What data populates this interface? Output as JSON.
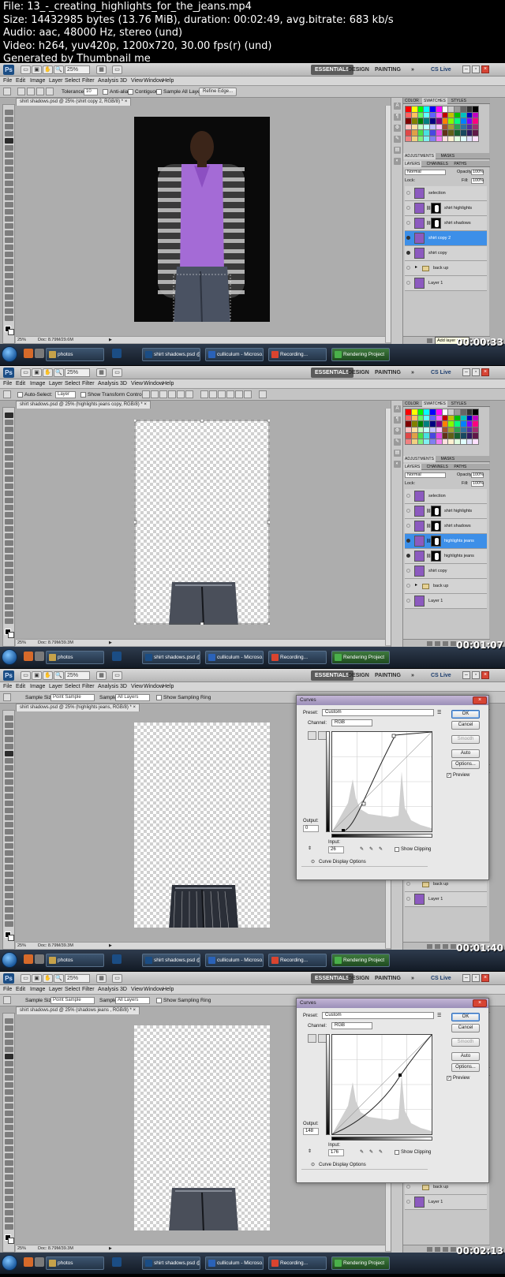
{
  "header": {
    "file": "File: 13_-_creating_highlights_for_the_jeans.mp4",
    "size": "Size: 14432985 bytes (13.76 MiB), duration: 00:02:49, avg.bitrate: 683 kb/s",
    "audio": "Audio: aac, 48000 Hz, stereo (und)",
    "video": "Video: h264, yuv420p, 1200x720, 30.00 fps(r) (und)",
    "generated": "Generated by Thumbnail me"
  },
  "app": {
    "logo": "Ps",
    "zoom": "25%",
    "workspaces": [
      "ESSENTIALS",
      "DESIGN",
      "PAINTING"
    ],
    "more": "»",
    "cs_live": "CS Live",
    "menu": [
      "File",
      "Edit",
      "Image",
      "Layer",
      "Select",
      "Filter",
      "Analysis",
      "3D",
      "View",
      "Window",
      "Help"
    ],
    "panel_tabs_top": [
      "COLOR",
      "SWATCHES",
      "STYLES"
    ],
    "panel_tabs_mid": [
      "ADJUSTMENTS",
      "MASKS"
    ],
    "panel_tabs_layers": [
      "LAYERS",
      "CHANNELS",
      "PATHS"
    ],
    "blend_mode": "Normal",
    "opacity_label": "Opacity:",
    "opacity_value": "100%",
    "lock_label": "Lock:",
    "fill_label": "Fill:",
    "fill_value": "100%",
    "status_zoom": "25%",
    "status_doc": "Doc: 8.79M/29.6M",
    "status_doc2": "Doc: 8.79M/39.3M"
  },
  "frames": [
    {
      "options": {
        "tolerance_label": "Tolerance:",
        "tolerance_value": "10",
        "anti_alias": "Anti-alias",
        "contiguous": "Contiguous",
        "sample_all": "Sample All Layers",
        "refine_edge": "Refine Edge..."
      },
      "doc_tab": "shirt shadows.psd @ 25% (shirt copy 2, RGB/8) *",
      "layers": [
        {
          "name": "selection",
          "visible": false,
          "mask": false,
          "selected": false
        },
        {
          "name": "shirt highlights",
          "visible": false,
          "mask": true,
          "selected": false
        },
        {
          "name": "shirt shadows",
          "visible": false,
          "mask": true,
          "selected": false
        },
        {
          "name": "shirt copy 2",
          "visible": true,
          "mask": false,
          "selected": true
        },
        {
          "name": "shirt copy",
          "visible": true,
          "mask": false,
          "selected": false
        },
        {
          "name": "back up",
          "visible": false,
          "folder": true,
          "selected": false
        },
        {
          "name": "Layer 1",
          "visible": false,
          "mask": false,
          "selected": false
        }
      ],
      "tooltip": "Add layer mask",
      "timestamp": "00:00:33"
    },
    {
      "options": {
        "auto_select": "Auto-Select:",
        "auto_select_value": "Layer",
        "show_transform": "Show Transform Controls"
      },
      "doc_tab": "shirt shadows.psd @ 25% (highlights jeans copy, RGB/8) *",
      "layers": [
        {
          "name": "selection",
          "visible": false,
          "mask": false,
          "selected": false
        },
        {
          "name": "shirt highlights",
          "visible": false,
          "mask": true,
          "selected": false
        },
        {
          "name": "shirt shadows",
          "visible": false,
          "mask": true,
          "selected": false
        },
        {
          "name": "highlights jeans",
          "visible": true,
          "mask": true,
          "selected": true
        },
        {
          "name": "highlights jeans",
          "visible": true,
          "mask": true,
          "selected": false
        },
        {
          "name": "shirt copy",
          "visible": false,
          "mask": false,
          "selected": false
        },
        {
          "name": "back up",
          "visible": false,
          "folder": true,
          "selected": false
        },
        {
          "name": "Layer 1",
          "visible": false,
          "mask": false,
          "selected": false
        }
      ],
      "timestamp": "00:01:07"
    },
    {
      "options": {
        "sample_size_label": "Sample Size:",
        "sample_size_value": "Point Sample",
        "sample_label": "Sample:",
        "sample_value": "All Layers",
        "show_ring": "Show Sampling Ring"
      },
      "doc_tab": "shirt shadows.psd @ 25% (highlights jeans, RGB/8) *",
      "curves": {
        "title": "Curves",
        "preset_label": "Preset:",
        "preset_value": "Custom",
        "channel_label": "Channel:",
        "channel_value": "RGB",
        "output_label": "Output:",
        "output_value": "0",
        "input_label": "Input:",
        "input_value": "26",
        "show_clipping": "Show Clipping",
        "display_options": "Curve Display Options",
        "ok": "OK",
        "cancel": "Cancel",
        "smooth": "Smooth",
        "auto": "Auto",
        "options": "Options...",
        "preview": "Preview"
      },
      "layers_visible": [
        "back up",
        "Layer 1"
      ],
      "timestamp": "00:01:40"
    },
    {
      "options": {
        "sample_size_label": "Sample Size:",
        "sample_size_value": "Point Sample",
        "sample_label": "Sample:",
        "sample_value": "All Layers",
        "show_ring": "Show Sampling Ring"
      },
      "doc_tab": "shirt shadows.psd @ 25% (shadows jeans , RGB/8) *",
      "curves": {
        "title": "Curves",
        "preset_label": "Preset:",
        "preset_value": "Custom",
        "channel_label": "Channel:",
        "channel_value": "RGB",
        "output_label": "Output:",
        "output_value": "148",
        "input_label": "Input:",
        "input_value": "176",
        "show_clipping": "Show Clipping",
        "display_options": "Curve Display Options",
        "ok": "OK",
        "cancel": "Cancel",
        "smooth": "Smooth",
        "auto": "Auto",
        "options": "Options...",
        "preview": "Preview"
      },
      "layers_visible": [
        "back up",
        "Layer 1"
      ],
      "timestamp": "00:02:13"
    }
  ],
  "taskbar": {
    "tasks": [
      "photos",
      "shirt shadows.psd @...",
      "culliculum - Microso...",
      "Recording...",
      "Rendering Project"
    ]
  },
  "colors": {
    "selected_layer": "#3d8fe8",
    "shirt_purple": "#a46bd6",
    "jeans": "#4a5262"
  }
}
